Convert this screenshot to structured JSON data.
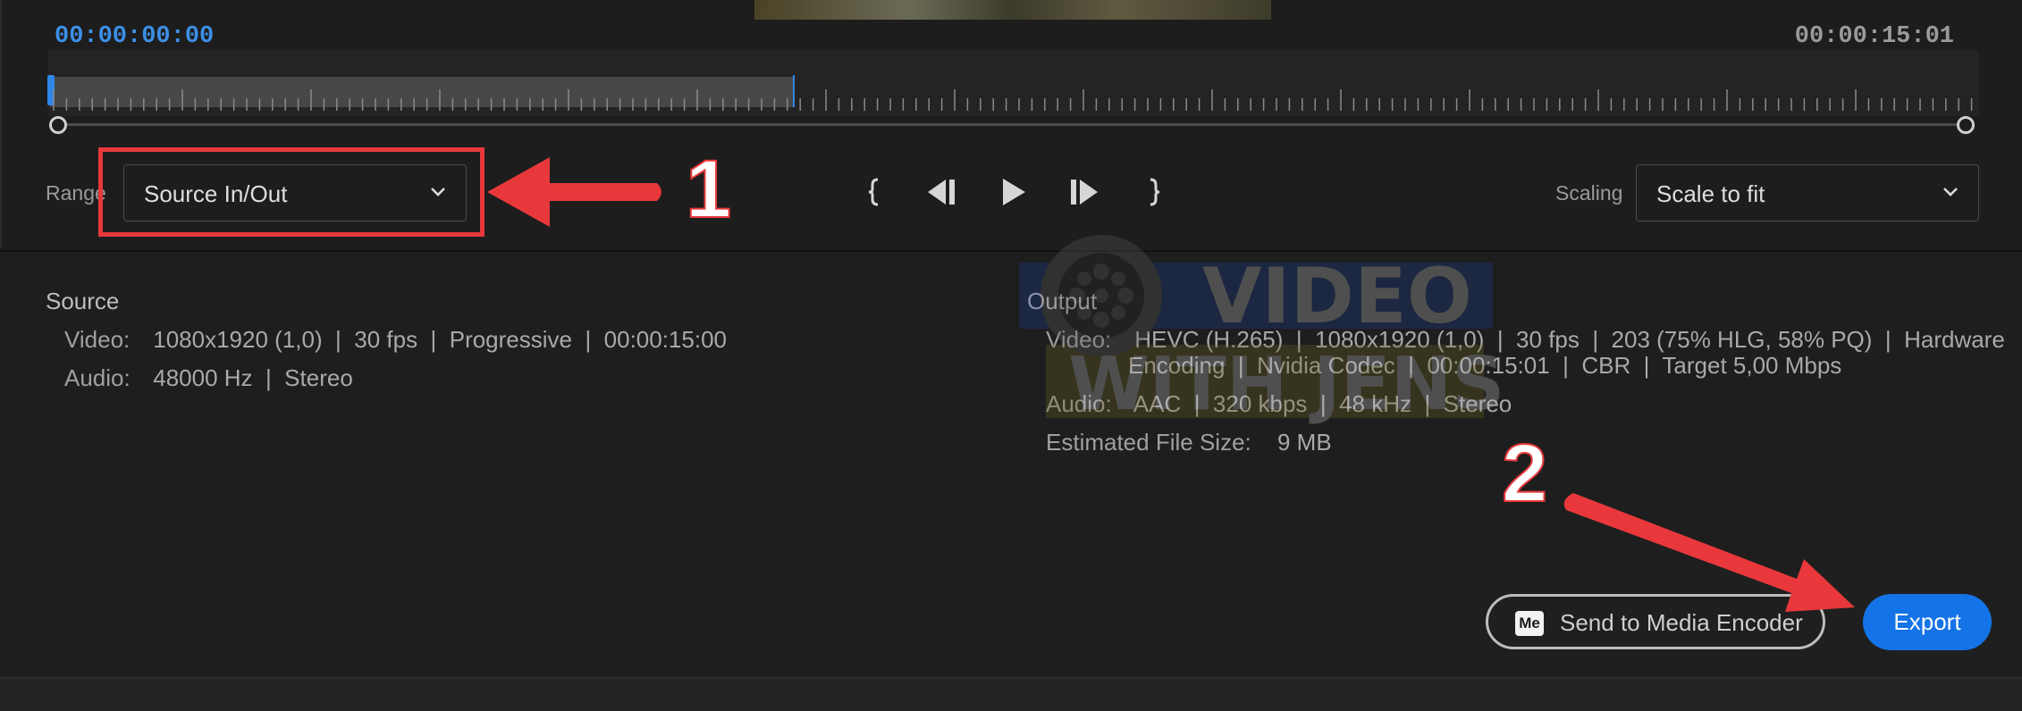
{
  "timeline": {
    "in_timecode": "00:00:00:00",
    "out_timecode": "00:00:15:01",
    "range_fraction": 0.387
  },
  "controls": {
    "range_label": "Range",
    "range_value": "Source In/Out",
    "scaling_label": "Scaling",
    "scaling_value": "Scale to fit",
    "transport_icons": [
      "set-in-icon",
      "step-back-icon",
      "play-icon",
      "step-forward-icon",
      "set-out-icon"
    ]
  },
  "source": {
    "title": "Source",
    "video_label": "Video:",
    "video_value": "1080x1920 (1,0)  |  30 fps  |  Progressive  |  00:00:15:00",
    "audio_label": "Audio:",
    "audio_value": "48000 Hz  |  Stereo"
  },
  "output": {
    "title": "Output",
    "video_label": "Video:",
    "video_line1": "HEVC (H.265)  |  1080x1920 (1,0)  |  30 fps  |  203 (75% HLG, 58% PQ)  |  Hardware",
    "video_line2": "Encoding  |  Nvidia Codec  |  00:00:15:01  |  CBR  |  Target 5,00 Mbps",
    "audio_label": "Audio:",
    "audio_value": "AAC  |  320 kbps  |  48 kHz  |  Stereo",
    "size_label": "Estimated File Size:",
    "size_value": "9 MB"
  },
  "footer": {
    "me_icon_text": "Me",
    "send_label": "Send to Media Encoder",
    "export_label": "Export"
  },
  "annotations": {
    "callout_1": "1",
    "callout_2": "2"
  },
  "watermark": {
    "line1": "VIDEO",
    "line2": "WITH JENS"
  },
  "colors": {
    "accent": "#1473e6",
    "timecode_in": "#3d8fe6",
    "highlight": "#e8383b",
    "background": "#1d1d1d"
  }
}
